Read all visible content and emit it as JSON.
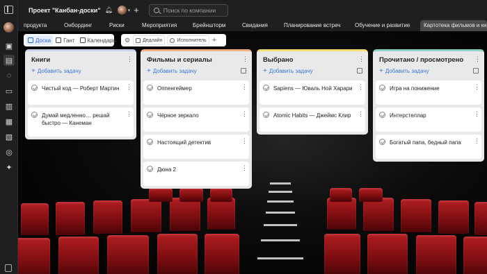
{
  "header": {
    "project_title": "Проект \"Канбан-доски\"",
    "search_placeholder": "Поиск по компании"
  },
  "tabs": [
    {
      "label": "продукта"
    },
    {
      "label": "Онбординг"
    },
    {
      "label": "Риски"
    },
    {
      "label": "Мероприятия"
    },
    {
      "label": "Брейншторм"
    },
    {
      "label": "Свидания"
    },
    {
      "label": "Планирование встреч"
    },
    {
      "label": "Обучение и развитие"
    },
    {
      "label": "Картотека фильмов и кни",
      "active": true
    }
  ],
  "views": {
    "board": "Доска",
    "gantt": "Гант",
    "calendar": "Календарь"
  },
  "filters": {
    "deadline": "Дедлайн",
    "assignee": "Исполнитель"
  },
  "add_task_label": "Добавить задачу",
  "columns": [
    {
      "title": "Книги",
      "accent": "#c9d0ea",
      "cards": [
        "Чистый код — Роберт Мартин",
        "Думай медленно… решай быстро — Канеман"
      ]
    },
    {
      "title": "Фильмы и сериалы",
      "accent": "#f0b27a",
      "cards": [
        "Оппенгеймер",
        "Чёрное зеркало",
        "Настоящий детектив",
        "Дюна 2"
      ]
    },
    {
      "title": "Выбрано",
      "accent": "#f4dc6e",
      "cards": [
        "Sapiens — Юваль Ной Харари",
        "Atomic Habits — Джеймс Клир"
      ]
    },
    {
      "title": "Прочитано / просмотрено",
      "accent": "#8fd3c6",
      "cards": [
        "Игра на понижение",
        "Интерстеллар",
        "Богатый папа, бедный папа"
      ]
    }
  ]
}
